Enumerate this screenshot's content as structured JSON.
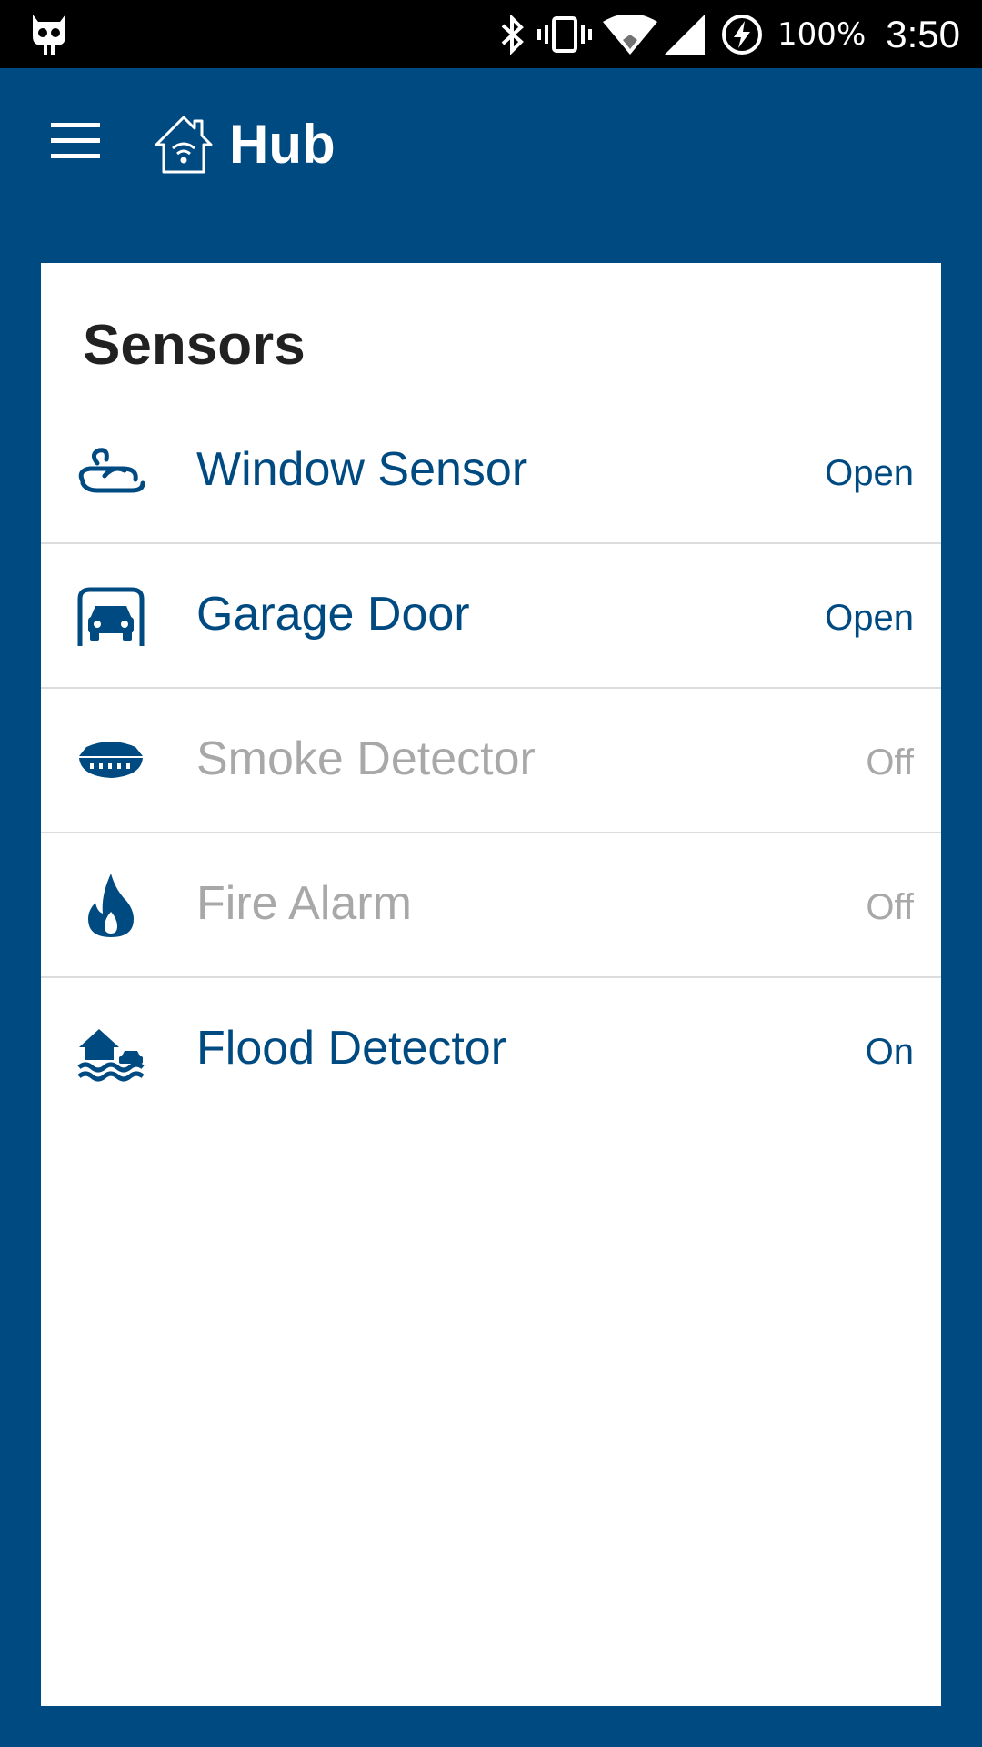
{
  "status_bar": {
    "left_icon": "cyanogen-robot-icon",
    "icons": [
      "bluetooth-icon",
      "vibrate-icon",
      "wifi-icon",
      "cell-signal-icon",
      "battery-charging-icon"
    ],
    "battery": "100%",
    "time": "3:50"
  },
  "app_bar": {
    "menu_icon": "hamburger-menu-icon",
    "logo_icon": "smart-home-icon",
    "title": "Hub"
  },
  "card": {
    "title": "Sensors",
    "sensors": [
      {
        "name": "Window Sensor",
        "state": "Open",
        "icon": "wind-icon",
        "active": true
      },
      {
        "name": "Garage Door",
        "state": "Open",
        "icon": "garage-car-icon",
        "active": true
      },
      {
        "name": "Smoke Detector",
        "state": "Off",
        "icon": "smoke-detector-icon",
        "active": false
      },
      {
        "name": "Fire Alarm",
        "state": "Off",
        "icon": "flame-icon",
        "active": false
      },
      {
        "name": "Flood Detector",
        "state": "On",
        "icon": "flood-house-icon",
        "active": true
      }
    ]
  },
  "colors": {
    "primary": "#004a82",
    "status_bar": "#000000",
    "card_bg": "#ffffff",
    "inactive_text": "#a8a8a8",
    "title_text": "#212121",
    "divider": "#dcdcdc"
  }
}
